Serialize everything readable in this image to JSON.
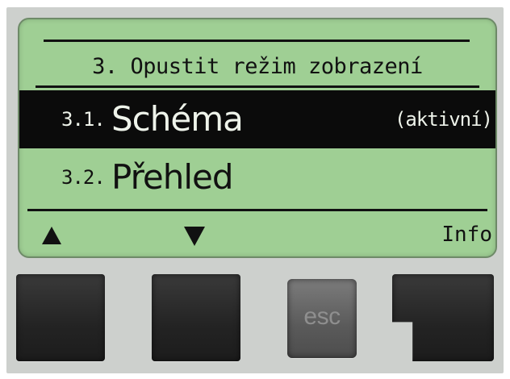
{
  "screen": {
    "title": "3. Opustit režim zobrazení",
    "items": [
      {
        "number": "3.1.",
        "label": "Schéma",
        "badge": "(aktivní)",
        "selected": true
      },
      {
        "number": "3.2.",
        "label": "Přehled",
        "badge": "",
        "selected": false
      }
    ],
    "softkeys": {
      "left_icon": "arrow-up-icon",
      "middle_icon": "arrow-down-icon",
      "right_label": "Info"
    }
  },
  "buttons": {
    "esc_label": "esc"
  },
  "colors": {
    "lcd_background": "#9fcf94",
    "device_body": "#cdd0cd",
    "highlight": "#0b0b0b"
  }
}
